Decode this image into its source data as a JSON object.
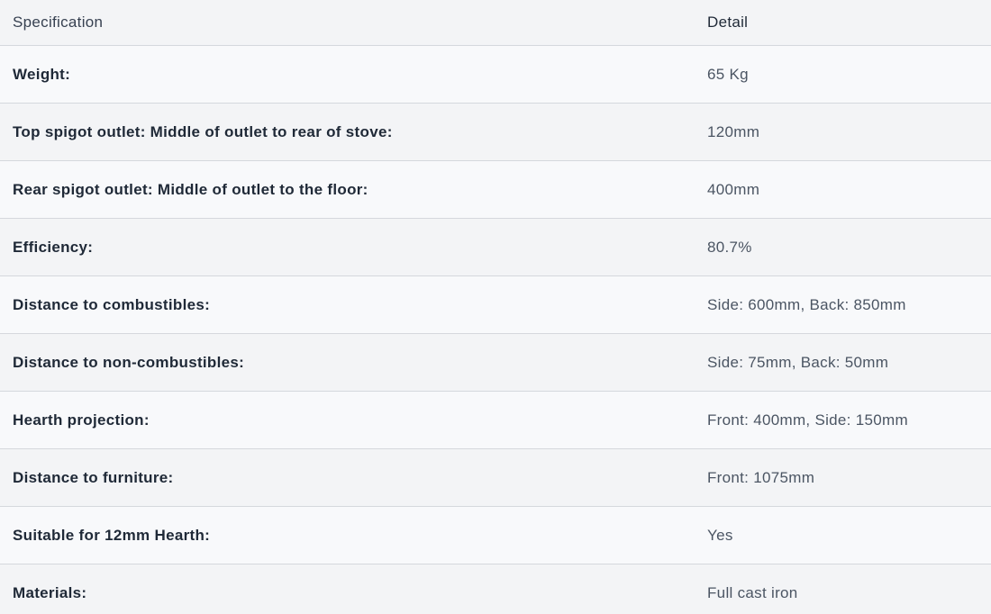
{
  "table": {
    "headers": {
      "specification": "Specification",
      "detail": "Detail"
    },
    "rows": [
      {
        "label": "Weight:",
        "value": "65 Kg"
      },
      {
        "label": "Top spigot outlet: Middle of outlet to rear of stove:",
        "value": "120mm"
      },
      {
        "label": "Rear spigot outlet: Middle of outlet to the floor:",
        "value": "400mm"
      },
      {
        "label": "Efficiency:",
        "value": "80.7%"
      },
      {
        "label": "Distance to combustibles:",
        "value": "Side: 600mm, Back: 850mm"
      },
      {
        "label": "Distance to non-combustibles:",
        "value": "Side: 75mm, Back: 50mm"
      },
      {
        "label": "Hearth projection:",
        "value": "Front: 400mm, Side: 150mm"
      },
      {
        "label": "Distance to furniture:",
        "value": "Front: 1075mm"
      },
      {
        "label": "Suitable for 12mm Hearth:",
        "value": "Yes"
      },
      {
        "label": "Materials:",
        "value": "Full cast iron"
      }
    ]
  }
}
